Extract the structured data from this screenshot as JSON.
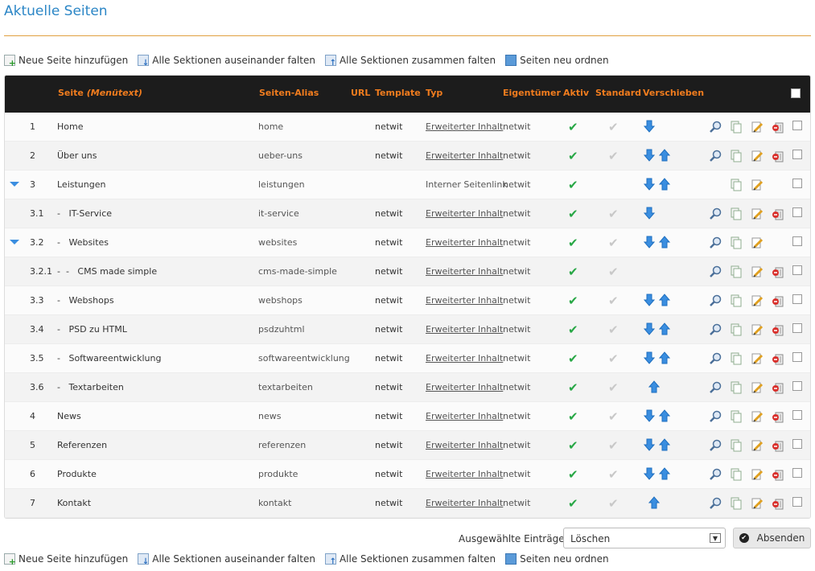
{
  "page": {
    "title": "Aktuelle Seiten"
  },
  "actions_top": [
    {
      "label": "Neue Seite hinzufügen",
      "icon": "add-page-icon"
    },
    {
      "label": "Alle Sektionen auseinander falten",
      "icon": "expand-all-icon"
    },
    {
      "label": "Alle Sektionen zusammen falten",
      "icon": "collapse-all-icon"
    },
    {
      "label": "Seiten neu ordnen",
      "icon": "reorder-icon"
    }
  ],
  "actions_bottom": [
    {
      "label": "Neue Seite hinzufügen",
      "icon": "add-page-icon"
    },
    {
      "label": "Alle Sektionen auseinander falten",
      "icon": "expand-all-icon"
    },
    {
      "label": "Alle Sektionen zusammen falten",
      "icon": "collapse-all-icon"
    },
    {
      "label": "Seiten neu ordnen",
      "icon": "reorder-icon"
    }
  ],
  "table": {
    "headers": {
      "seite": "Seite",
      "seite_sub": "(Menütext)",
      "alias": "Seiten-Alias",
      "url": "URL",
      "template": "Template",
      "typ": "Typ",
      "owner": "Eigentümer",
      "aktiv": "Aktiv",
      "standard": "Standard",
      "verschieben": "Verschieben"
    },
    "rows": [
      {
        "num": "1",
        "name": "Home",
        "alias": "home",
        "template": "netwit",
        "typ": "Erweiterter Inhalt",
        "typ_link": true,
        "owner": "netwit",
        "aktiv": true,
        "standard": true,
        "down": true,
        "up": false,
        "expander": false,
        "view": true,
        "copy": true,
        "edit": true,
        "delete": true
      },
      {
        "num": "2",
        "name": "Über uns",
        "alias": "ueber-uns",
        "template": "netwit",
        "typ": "Erweiterter Inhalt",
        "typ_link": true,
        "owner": "netwit",
        "aktiv": true,
        "standard": true,
        "down": true,
        "up": true,
        "expander": false,
        "view": true,
        "copy": true,
        "edit": true,
        "delete": true
      },
      {
        "num": "3",
        "name": "Leistungen",
        "alias": "leistungen",
        "template": "",
        "typ": "Interner Seitenlink",
        "typ_link": false,
        "owner": "netwit",
        "aktiv": true,
        "standard": false,
        "down": true,
        "up": true,
        "expander": true,
        "view": false,
        "copy": true,
        "edit": true,
        "delete": false
      },
      {
        "num": "3.1",
        "name": "-   IT-Service",
        "alias": "it-service",
        "template": "netwit",
        "typ": "Erweiterter Inhalt",
        "typ_link": true,
        "owner": "netwit",
        "aktiv": true,
        "standard": true,
        "down": true,
        "up": false,
        "expander": false,
        "view": true,
        "copy": true,
        "edit": true,
        "delete": true
      },
      {
        "num": "3.2",
        "name": "-   Websites",
        "alias": "websites",
        "template": "netwit",
        "typ": "Erweiterter Inhalt",
        "typ_link": true,
        "owner": "netwit",
        "aktiv": true,
        "standard": true,
        "down": true,
        "up": true,
        "expander": true,
        "view": true,
        "copy": true,
        "edit": true,
        "delete": false
      },
      {
        "num": "3.2.1",
        "name": "-  -   CMS made simple",
        "alias": "cms-made-simple",
        "template": "netwit",
        "typ": "Erweiterter Inhalt",
        "typ_link": true,
        "owner": "netwit",
        "aktiv": true,
        "standard": true,
        "down": false,
        "up": false,
        "expander": false,
        "view": true,
        "copy": true,
        "edit": true,
        "delete": true
      },
      {
        "num": "3.3",
        "name": "-   Webshops",
        "alias": "webshops",
        "template": "netwit",
        "typ": "Erweiterter Inhalt",
        "typ_link": true,
        "owner": "netwit",
        "aktiv": true,
        "standard": true,
        "down": true,
        "up": true,
        "expander": false,
        "view": true,
        "copy": true,
        "edit": true,
        "delete": true
      },
      {
        "num": "3.4",
        "name": "-   PSD zu HTML",
        "alias": "psdzuhtml",
        "template": "netwit",
        "typ": "Erweiterter Inhalt",
        "typ_link": true,
        "owner": "netwit",
        "aktiv": true,
        "standard": true,
        "down": true,
        "up": true,
        "expander": false,
        "view": true,
        "copy": true,
        "edit": true,
        "delete": true
      },
      {
        "num": "3.5",
        "name": "-   Softwareentwicklung",
        "alias": "softwareentwicklung",
        "template": "netwit",
        "typ": "Erweiterter Inhalt",
        "typ_link": true,
        "owner": "netwit",
        "aktiv": true,
        "standard": true,
        "down": true,
        "up": true,
        "expander": false,
        "view": true,
        "copy": true,
        "edit": true,
        "delete": true
      },
      {
        "num": "3.6",
        "name": "-   Textarbeiten",
        "alias": "textarbeiten",
        "template": "netwit",
        "typ": "Erweiterter Inhalt",
        "typ_link": true,
        "owner": "netwit",
        "aktiv": true,
        "standard": true,
        "down": false,
        "up": true,
        "expander": false,
        "view": true,
        "copy": true,
        "edit": true,
        "delete": true
      },
      {
        "num": "4",
        "name": "News",
        "alias": "news",
        "template": "netwit",
        "typ": "Erweiterter Inhalt",
        "typ_link": true,
        "owner": "netwit",
        "aktiv": true,
        "standard": true,
        "down": true,
        "up": true,
        "expander": false,
        "view": true,
        "copy": true,
        "edit": true,
        "delete": true
      },
      {
        "num": "5",
        "name": "Referenzen",
        "alias": "referenzen",
        "template": "netwit",
        "typ": "Erweiterter Inhalt",
        "typ_link": true,
        "owner": "netwit",
        "aktiv": true,
        "standard": true,
        "down": true,
        "up": true,
        "expander": false,
        "view": true,
        "copy": true,
        "edit": true,
        "delete": true
      },
      {
        "num": "6",
        "name": "Produkte",
        "alias": "produkte",
        "template": "netwit",
        "typ": "Erweiterter Inhalt",
        "typ_link": true,
        "owner": "netwit",
        "aktiv": true,
        "standard": true,
        "down": true,
        "up": true,
        "expander": false,
        "view": true,
        "copy": true,
        "edit": true,
        "delete": true
      },
      {
        "num": "7",
        "name": "Kontakt",
        "alias": "kontakt",
        "template": "netwit",
        "typ": "Erweiterter Inhalt",
        "typ_link": true,
        "owner": "netwit",
        "aktiv": true,
        "standard": true,
        "down": false,
        "up": true,
        "expander": false,
        "view": true,
        "copy": true,
        "edit": true,
        "delete": true
      }
    ]
  },
  "bulk": {
    "label": "Ausgewählte Einträge:",
    "selected": "Löschen",
    "submit": "Absenden"
  },
  "colors": {
    "title": "#2b86c6",
    "header_bg": "#1c1c1c",
    "header_text": "#f07c1e",
    "active_check": "#27a745",
    "move_arrow": "#3a8ee0"
  }
}
